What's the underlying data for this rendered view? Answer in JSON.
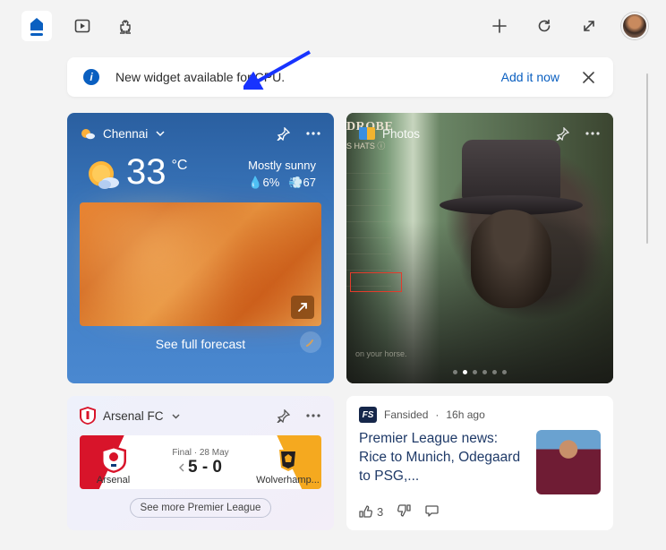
{
  "notice": {
    "text": "New widget available for CPU.",
    "action": "Add it now"
  },
  "weather": {
    "location": "Chennai",
    "temp": "33",
    "unit": "°C",
    "condition": "Mostly sunny",
    "humidity": "6%",
    "wind": "67",
    "forecast_link": "See full forecast"
  },
  "photos": {
    "label": "Photos",
    "overlay_title": "DROBE",
    "overlay_sub": "S HATS ⓘ"
  },
  "arsenal": {
    "title": "Arsenal FC",
    "home": "Arsenal",
    "away": "Wolverhamp...",
    "status": "Final · 28 May",
    "score": "5 - 0",
    "see_more": "See more Premier League"
  },
  "news": {
    "source": "Fansided",
    "badge": "FS",
    "time": "16h ago",
    "title": "Premier League news: Rice to Munich, Odegaard to PSG,...",
    "likes": "3"
  }
}
